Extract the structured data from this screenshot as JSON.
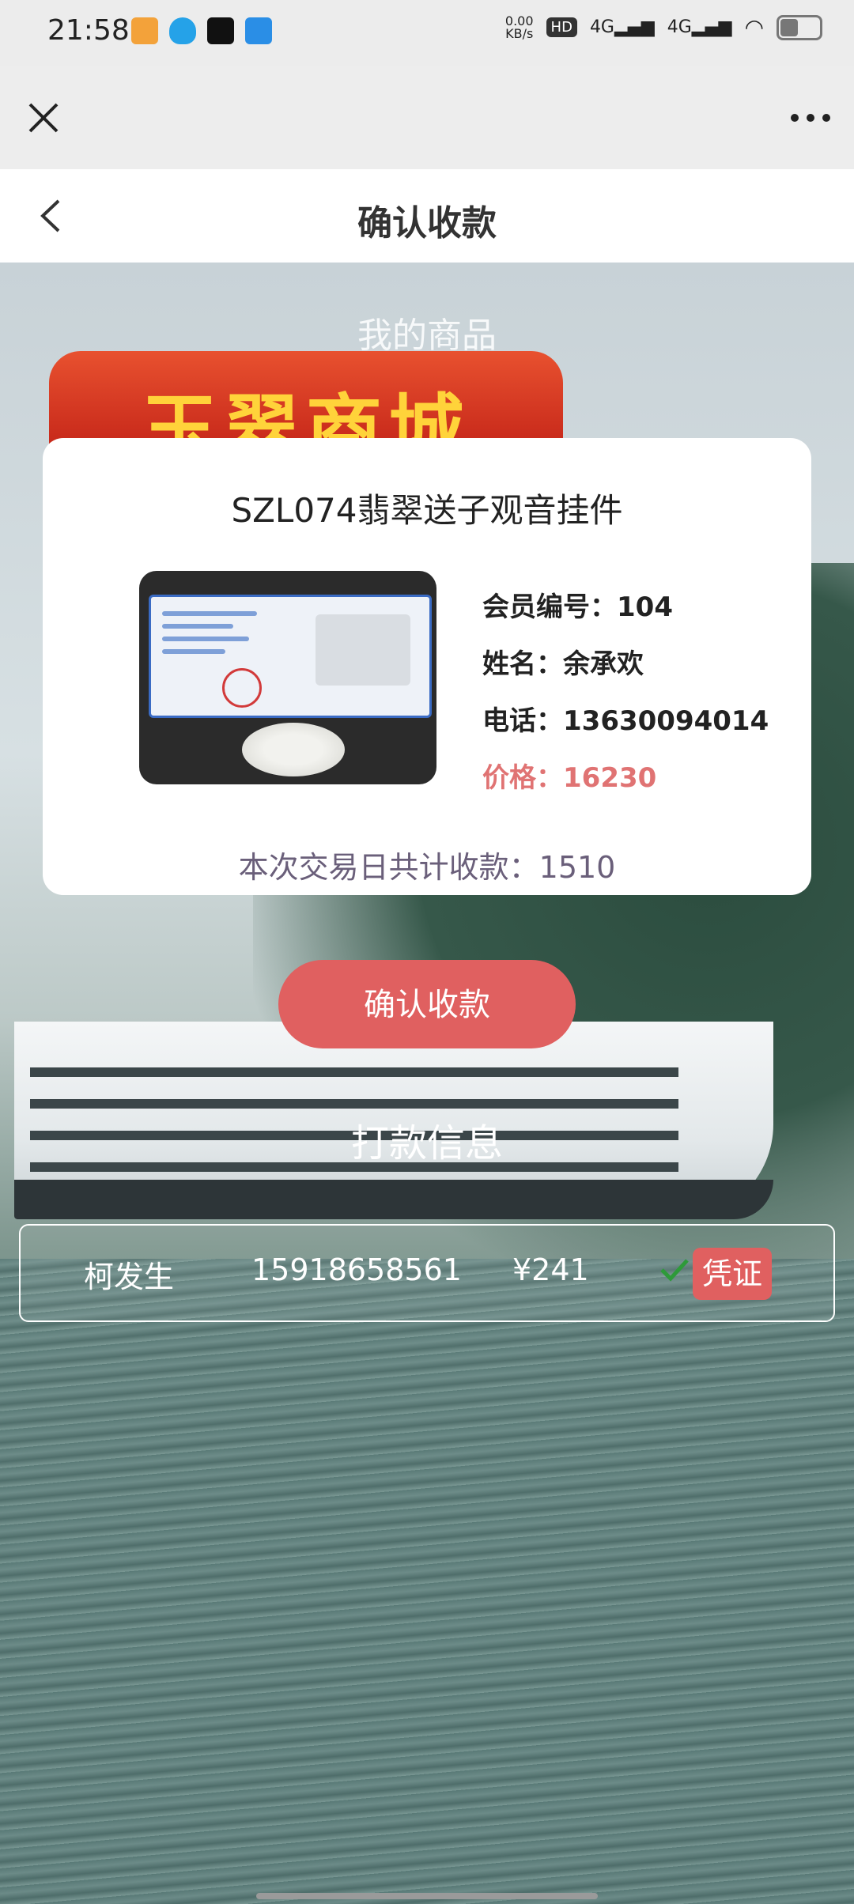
{
  "status_bar": {
    "time": "21:58",
    "net_speed_value": "0.00",
    "net_speed_unit": "KB/s",
    "hd_label": "HD",
    "signal1": "4G",
    "signal2": "4G"
  },
  "toolbar": {
    "close_icon": "close-icon",
    "more_icon": "more-icon"
  },
  "header": {
    "title": "确认收款"
  },
  "banner": {
    "section_title": "我的商品",
    "shop_name": "玉翠商城"
  },
  "product": {
    "name": "SZL074翡翠送子观音挂件",
    "member_id_label": "会员编号：104",
    "name_label": "姓名：余承欢",
    "phone_label": "电话：13630094014",
    "price_label": "价格：16230",
    "total_today": "本次交易日共计收款：1510"
  },
  "actions": {
    "confirm_label": "确认收款"
  },
  "payment_section": {
    "title": "打款信息",
    "rows": [
      {
        "name": "柯发生",
        "phone": "15918658561",
        "amount": "¥241",
        "voucher_label": "凭证"
      }
    ]
  },
  "colors": {
    "accent": "#e06060",
    "price": "#e07373",
    "check": "#2e9a3a"
  }
}
